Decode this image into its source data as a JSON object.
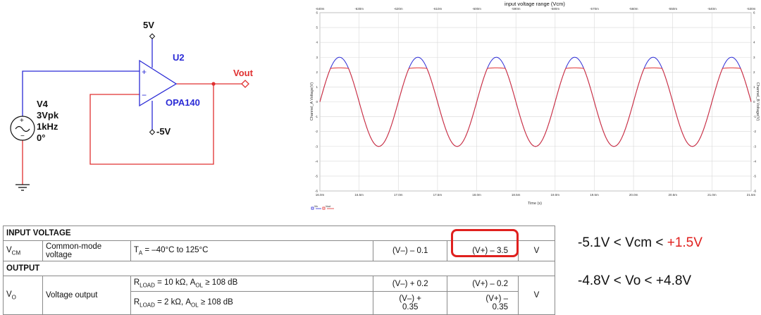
{
  "schematic": {
    "supply_pos": "5V",
    "supply_neg": "-5V",
    "opamp_ref": "U2",
    "opamp_part": "OPA140",
    "output_label": "Vout",
    "plus_sign": "+",
    "minus_sign": "−",
    "source": {
      "ref": "V4",
      "amplitude": "3Vpk",
      "frequency": "1kHz",
      "phase": "0°"
    }
  },
  "plot": {
    "title": "input voltage range (Vcm)",
    "top_ticks": [
      "-640m",
      "-630m",
      "-620m",
      "-610m",
      "-600m",
      "-590m",
      "-580m",
      "-570m",
      "-560m",
      "-550m",
      "-540m",
      "-530m"
    ],
    "left_ticks": [
      "6",
      "5",
      "4",
      "3",
      "2",
      "1",
      "0",
      "-1",
      "-2",
      "-3",
      "-4",
      "-5",
      "-6"
    ],
    "right_ticks": [
      "6",
      "5",
      "4",
      "3",
      "2",
      "1",
      "0",
      "-1",
      "-2",
      "-3",
      "-4",
      "-5",
      "-6"
    ],
    "bottom_ticks": [
      "16.0m",
      "16.5m",
      "17.0m",
      "17.5m",
      "18.0m",
      "18.5m",
      "19.0m",
      "19.5m",
      "20.0m",
      "20.5m",
      "21.0m",
      "21.5m"
    ],
    "xlabel": "Time (s)",
    "ylabel_left": "Channel_A Voltage(V)",
    "ylabel_right": "Channel_B Voltage(V)",
    "legend": [
      "Vin",
      "Vout"
    ],
    "colors": {
      "input": "#2b2bd6",
      "output": "#e03030"
    }
  },
  "chart_data": {
    "type": "line",
    "x_unit": "ms",
    "xlim": [
      16.0,
      21.5
    ],
    "ylim": [
      -6,
      6
    ],
    "grid": true,
    "series": [
      {
        "name": "Vin",
        "color": "#2b2bd6",
        "amplitude": 3.0,
        "frequency_khz": 1.0,
        "phase_deg": 0
      },
      {
        "name": "Vout",
        "color": "#e03030",
        "amplitude": 3.0,
        "frequency_khz": 1.0,
        "phase_deg": 0,
        "clip_high": 2.25
      }
    ]
  },
  "table": {
    "sec_input": "INPUT VOLTAGE",
    "vcm": {
      "sym": "V",
      "sub": "CM",
      "param": "Common-mode voltage",
      "cond_pre": "T",
      "cond_sub": "A",
      "cond_post": " = –40°C to 125°C",
      "min": "(V–) – 0.1",
      "max": "(V+) – 3.5",
      "unit": "V"
    },
    "sec_output": "OUTPUT",
    "vo": {
      "sym": "V",
      "sub": "O",
      "param": "Voltage output",
      "row1": {
        "r": "R",
        "rsub": "LOAD",
        "mid": " = 10 kΩ, A",
        "asub": "OL",
        "post": " ≥ 108 dB",
        "min": "(V–) + 0.2",
        "max": "(V+) – 0.2"
      },
      "row2": {
        "r": "R",
        "rsub": "LOAD",
        "mid": " = 2 kΩ, A",
        "asub": "OL",
        "post": " ≥ 108 dB",
        "min1": "(V–) +",
        "min2": "0.35",
        "max1": "(V+) –",
        "max2": "0.35"
      },
      "unit": "V"
    }
  },
  "annotations": {
    "vcm_pre": "-5.1V < Vcm < ",
    "vcm_hl": "+1.5V",
    "vo_range": "-4.8V < Vo < +4.8V",
    "highlight_color": "#e0201e"
  }
}
